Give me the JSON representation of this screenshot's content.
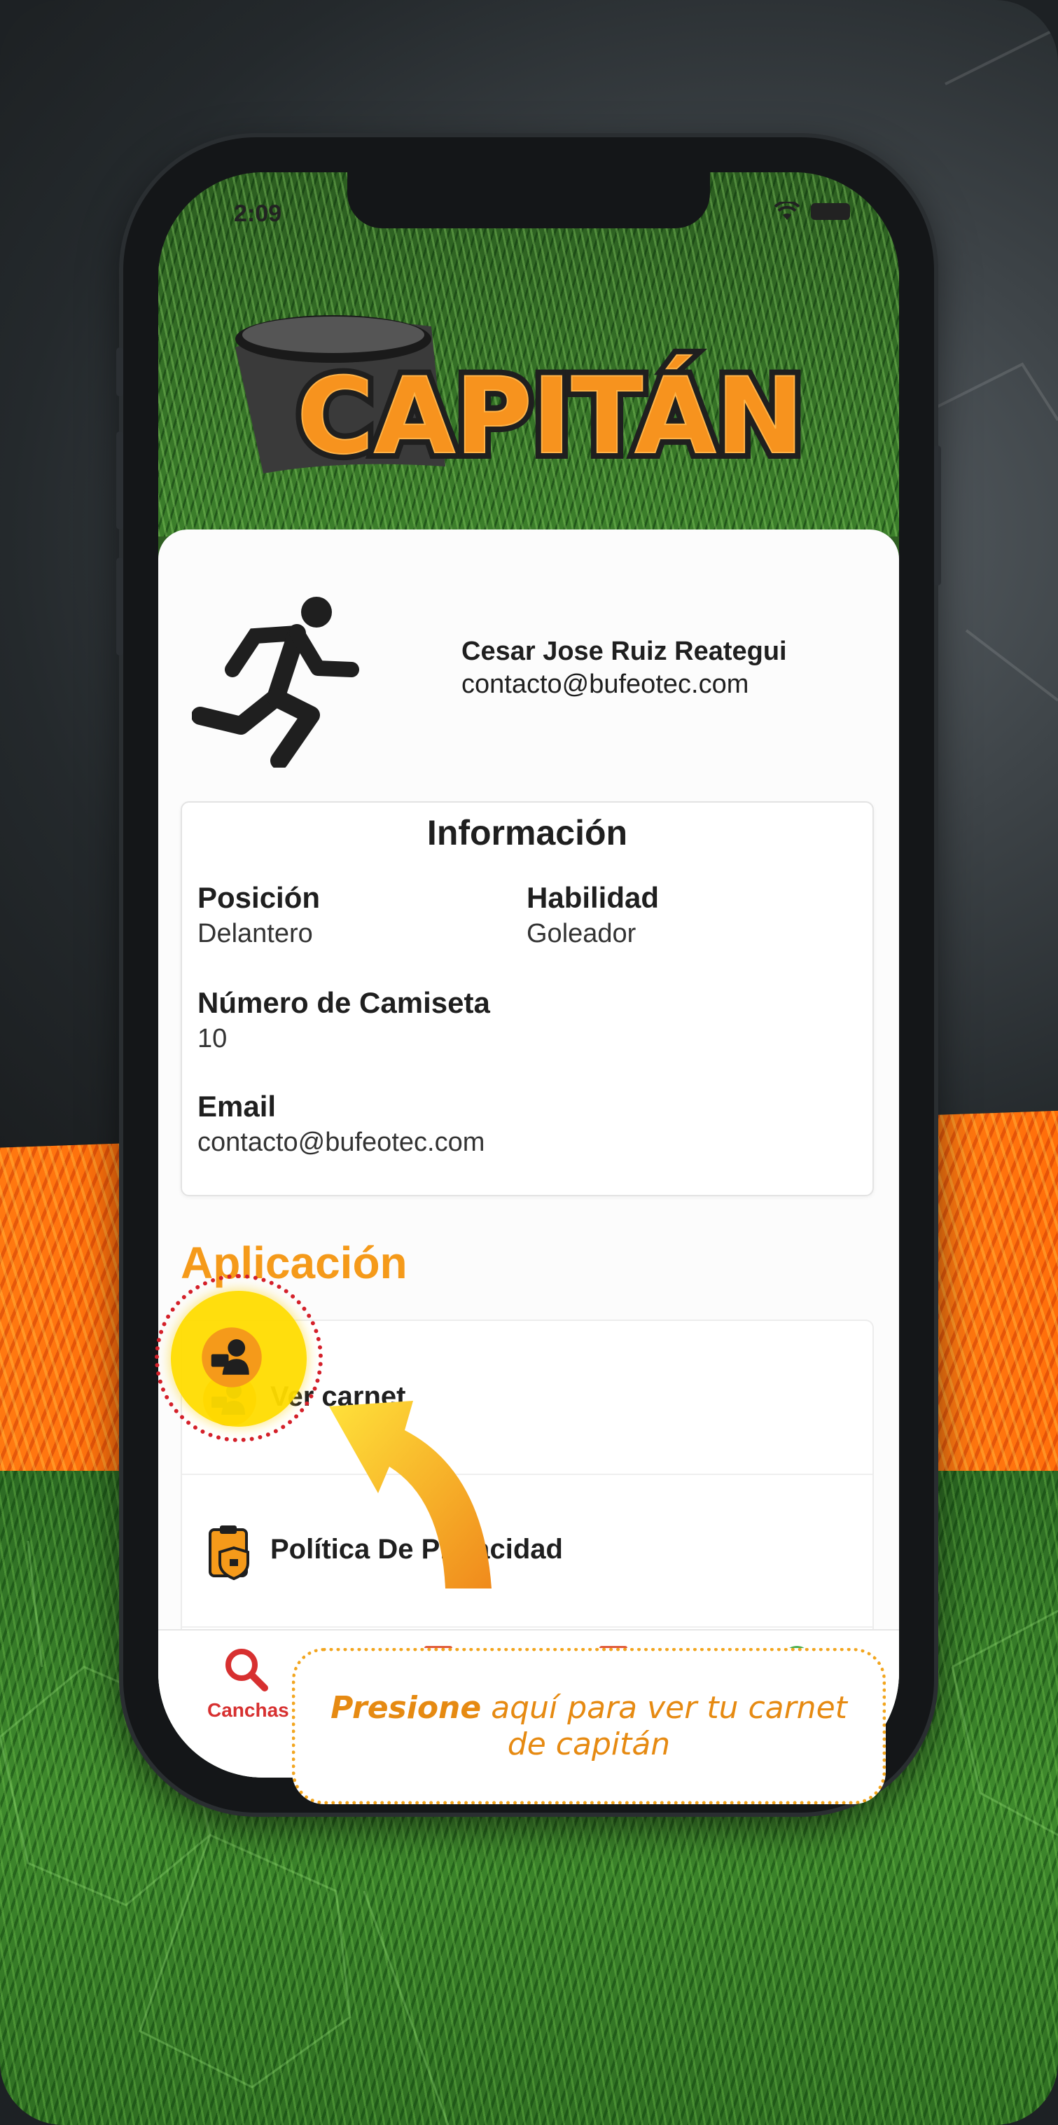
{
  "app": {
    "status_time": "2:09",
    "logo_text": "CAPITÁN"
  },
  "profile": {
    "name": "Cesar Jose Ruiz Reategui",
    "email": "contacto@bufeotec.com"
  },
  "info": {
    "title": "Información",
    "position_label": "Posición",
    "position_value": "Delantero",
    "skill_label": "Habilidad",
    "skill_value": "Goleador",
    "shirt_label": "Número de Camiseta",
    "shirt_value": "10",
    "email_label": "Email",
    "email_value": "contacto@bufeotec.com"
  },
  "application": {
    "title": "Aplicación",
    "items": [
      {
        "label": "Ver carnet",
        "icon": "id-card-icon"
      },
      {
        "label": "Política De Privacidad",
        "icon": "privacy-shield-icon"
      }
    ]
  },
  "tabbar": {
    "active_tab_label": "Canchas",
    "active_icon": "search-icon"
  },
  "tooltip": {
    "emphasis": "Presione",
    "text": " aquí para ver tu carnet de capitán"
  },
  "colors": {
    "accent_orange": "#f59a1a",
    "highlight_yellow": "#ffdc00",
    "ring_red": "#d4202a",
    "tab_active": "#d73030"
  }
}
